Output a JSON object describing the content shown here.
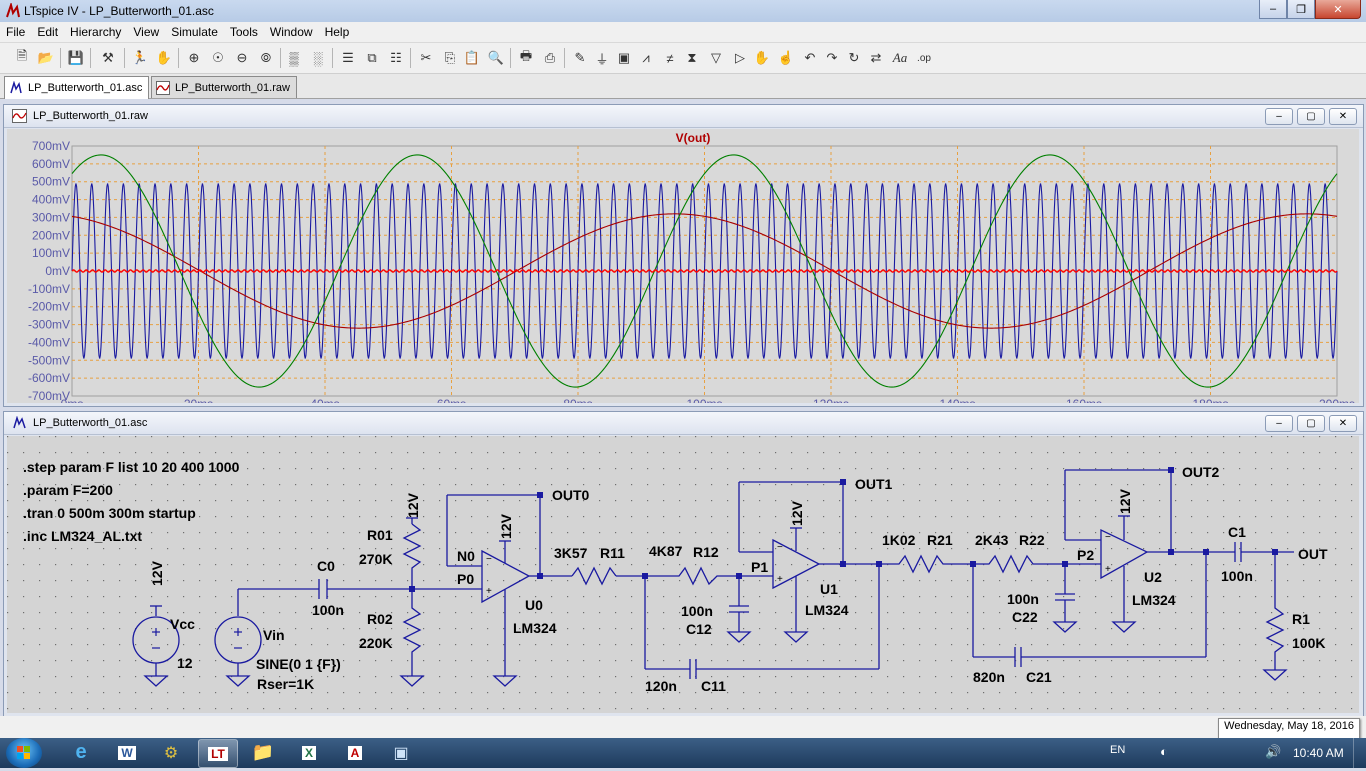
{
  "window": {
    "title": "LTspice IV - LP_Butterworth_01.asc"
  },
  "menu": [
    "File",
    "Edit",
    "Hierarchy",
    "View",
    "Simulate",
    "Tools",
    "Window",
    "Help"
  ],
  "tabs": [
    {
      "label": "LP_Butterworth_01.asc"
    },
    {
      "label": "LP_Butterworth_01.raw"
    }
  ],
  "plot_window": {
    "title": "LP_Butterworth_01.raw"
  },
  "schematic_window": {
    "title": "LP_Butterworth_01.asc"
  },
  "chart_data": {
    "type": "line",
    "title": "V(out)",
    "xlabel": "",
    "ylabel": "",
    "x_unit": "ms",
    "xlim": [
      0,
      200
    ],
    "ylim": [
      -700,
      700
    ],
    "y_unit": "mV",
    "grid": true,
    "x_ticks": [
      "0ms",
      "20ms",
      "40ms",
      "60ms",
      "80ms",
      "100ms",
      "120ms",
      "140ms",
      "160ms",
      "180ms",
      "200ms"
    ],
    "y_ticks": [
      "700mV",
      "600mV",
      "500mV",
      "400mV",
      "300mV",
      "200mV",
      "100mV",
      "0mV",
      "-100mV",
      "-200mV",
      "-300mV",
      "-400mV",
      "-500mV",
      "-600mV",
      "-700mV"
    ],
    "series": [
      {
        "color": "#008000",
        "kind": "sine",
        "freq_hz": 20,
        "amplitude_mv": 650,
        "phase_deg": 57
      },
      {
        "color": "#aa0000",
        "kind": "sine",
        "freq_hz": 10,
        "amplitude_mv": 320,
        "phase_deg": 107
      },
      {
        "color": "#1a1aa0",
        "kind": "sine",
        "freq_hz": 400,
        "amplitude_mv": 490,
        "phase_deg": 0
      },
      {
        "color": "#ff0000",
        "kind": "sine",
        "freq_hz": 1000,
        "amplitude_mv": 6,
        "phase_deg": 0
      }
    ]
  },
  "schematic": {
    "directives": [
      ".step param F list 10 20 400 1000",
      ".param F=200",
      ".tran 0 500m 300m startup",
      ".inc LM324_AL.txt"
    ],
    "labels": {
      "vcc_supply": "12V",
      "vcc_name": "Vcc",
      "vcc_value": "12",
      "vin_name": "Vin",
      "vin_value": "SINE(0 1 {F})",
      "vin_rser": "Rser=1K",
      "c0_name": "C0",
      "c0_value": "100n",
      "r01_name": "R01",
      "r01_value": "270K",
      "r01_supply": "12V",
      "r02_name": "R02",
      "r02_value": "220K",
      "n0": "N0",
      "p0": "P0",
      "u0_supply": "12V",
      "u0_name": "U0",
      "u0_model": "LM324",
      "out0": "OUT0",
      "r11_value": "3K57",
      "r11_name": "R11",
      "r12_value": "4K87",
      "r12_name": "R12",
      "c12_value": "100n",
      "c12_name": "C12",
      "c11_value": "120n",
      "c11_name": "C11",
      "p1": "P1",
      "u1_supply": "12V",
      "u1_name": "U1",
      "u1_model": "LM324",
      "out1": "OUT1",
      "r21_value": "1K02",
      "r21_name": "R21",
      "r22_value": "2K43",
      "r22_name": "R22",
      "c22_value": "100n",
      "c22_name": "C22",
      "c21_value": "820n",
      "c21_name": "C21",
      "p2": "P2",
      "u2_supply": "12V",
      "u2_name": "U2",
      "u2_model": "LM324",
      "out2": "OUT2",
      "c1_name": "C1",
      "c1_value": "100n",
      "out": "OUT",
      "r1_name": "R1",
      "r1_value": "100K"
    }
  },
  "status": {
    "tooltip": "Wednesday, May 18, 2016"
  },
  "taskbar": {
    "language": "EN",
    "clock": "10:40 AM"
  }
}
